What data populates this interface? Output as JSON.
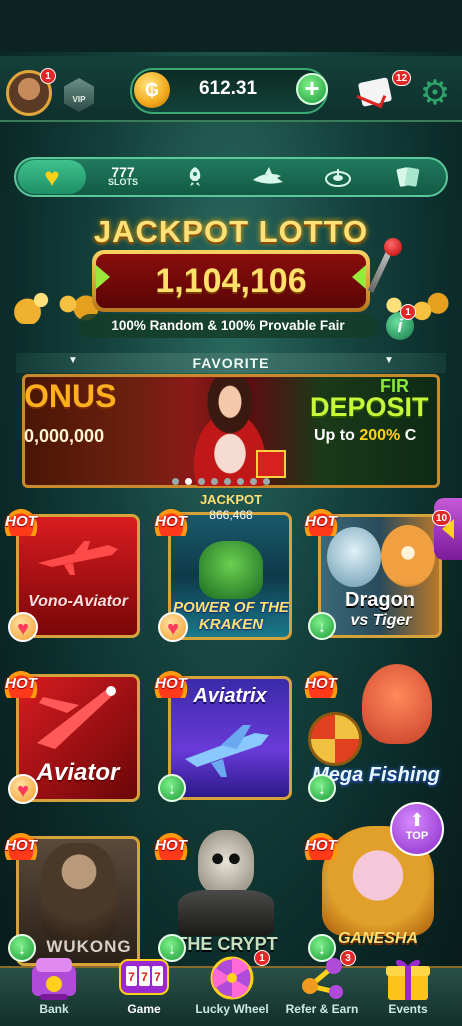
{
  "header": {
    "avatar_badge": "1",
    "vip_label": "VIP",
    "balance": "612.31",
    "coin_symbol": "₲",
    "mail_badge": "12"
  },
  "categories": [
    {
      "id": "favorite",
      "icon": "heart-icon"
    },
    {
      "id": "slots",
      "label": "SLOTS",
      "number": "777"
    },
    {
      "id": "crash",
      "icon": "rocket-icon"
    },
    {
      "id": "fishing",
      "icon": "shark-icon"
    },
    {
      "id": "roulette",
      "icon": "roulette-icon"
    },
    {
      "id": "cards",
      "icon": "cards-icon"
    }
  ],
  "jackpot": {
    "title": "JACKPOT LOTTO",
    "value": "1,104,106",
    "tagline": "100% Random & 100% Provable Fair",
    "info_badge": "1"
  },
  "favorite_label": "FAVORITE",
  "banner": {
    "bonus_text": "ONUS",
    "bonus_amount": "0,000,000",
    "first_text": "FIR",
    "deposit_text": "DEPOSIT",
    "upto_text": "Up to",
    "upto_percent": "200%",
    "upto_tail": "C"
  },
  "games": [
    {
      "title": "Vono-Aviator",
      "hot": "HOT"
    },
    {
      "title": "POWER OF THE KRAKEN",
      "hot": "HOT",
      "jackpot_label": "JACKPOT",
      "jackpot_value": "866,468"
    },
    {
      "title": "Dragon",
      "subtitle": "vs Tiger",
      "hot": "HOT"
    },
    {
      "title": "Aviator",
      "hot": "HOT"
    },
    {
      "title": "Aviatrix",
      "hot": "HOT"
    },
    {
      "title": "Mega Fishing",
      "hot": "HOT"
    },
    {
      "title": "WUKONG",
      "hot": "HOT"
    },
    {
      "title": "THE CRYPT",
      "hot": "HOT"
    },
    {
      "title": "GANESHA",
      "hot": "HOT"
    }
  ],
  "side_tab_count": "10",
  "top_button": {
    "label": "TOP"
  },
  "bottom_nav": [
    {
      "label": "Bank"
    },
    {
      "label": "Game"
    },
    {
      "label": "Lucky Wheel",
      "badge": "1"
    },
    {
      "label": "Refer & Earn",
      "badge": "3"
    },
    {
      "label": "Events"
    }
  ]
}
